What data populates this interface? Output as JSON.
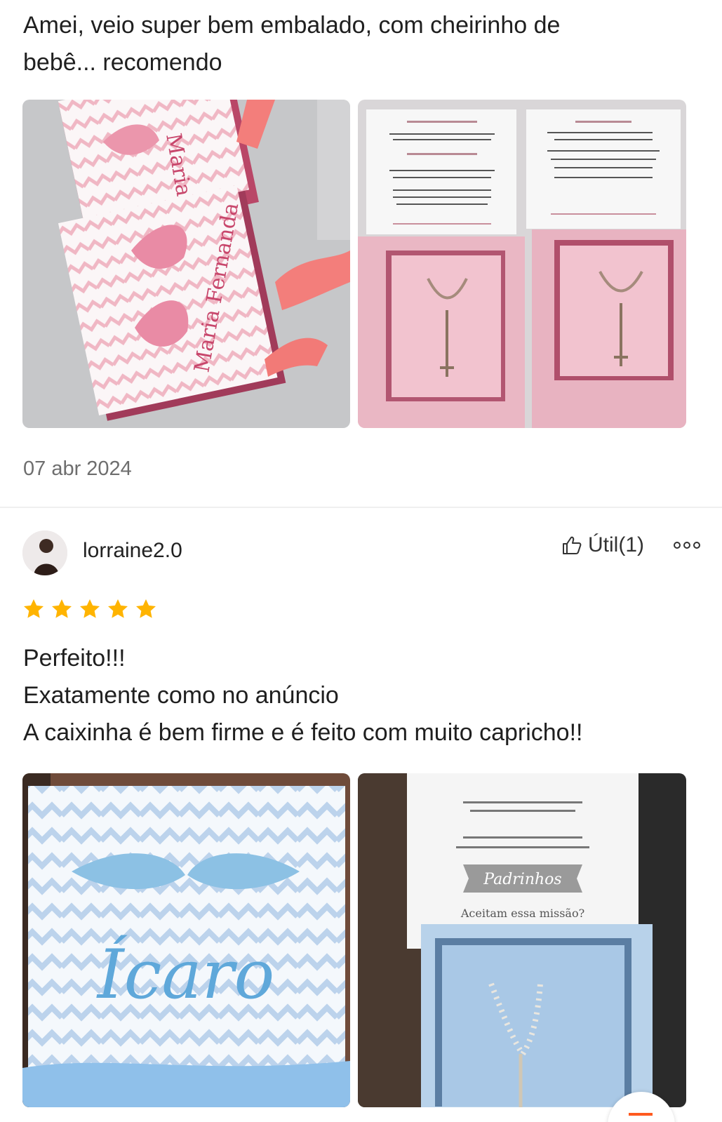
{
  "review1": {
    "text_line1": "Amei, veio super bem embalado, com cheirinho de",
    "text_line2": "bebê... recomendo",
    "date": "07 abr 2024",
    "photo_names": [
      "Maria",
      "Maria Fernanda"
    ]
  },
  "review2": {
    "username": "lorraine2.0",
    "helpful_label": "Útil(1)",
    "rating": 5,
    "star_color": "#ffb400",
    "lines": [
      "Perfeito!!!",
      "Exatamente como no anúncio",
      "A caixinha é bem firme e é feito com muito capricho!!"
    ],
    "photo_name": "Ícaro",
    "card_word": "Padrinhos",
    "card_question": "Aceitam essa missão?"
  }
}
